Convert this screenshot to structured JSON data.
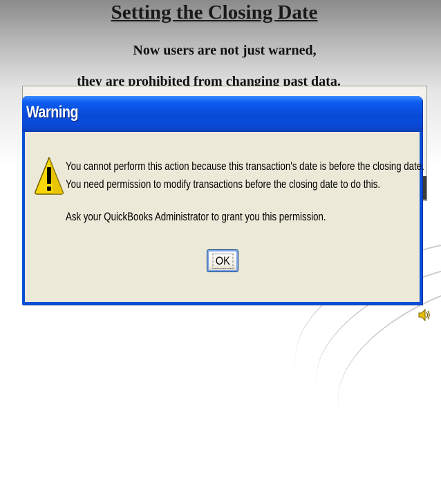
{
  "slide": {
    "title": "Setting the Closing Date",
    "subtitle_line1": "Now users are not just warned,",
    "subtitle_line2": "they are prohibited from changing past data."
  },
  "dialog": {
    "title": "Warning",
    "message_line1": "You cannot perform this action because this transaction's date is before the closing date.",
    "message_line2": "You need permission to modify transactions before the closing date to do this.",
    "message_line3": "Ask your QuickBooks Administrator to grant you this permission.",
    "ok_label": "OK",
    "icon": "warning-icon"
  },
  "audio_icon": "speaker-icon",
  "colors": {
    "titlebar": "#0a4fd6",
    "dialog_body": "#ece9d8",
    "warning_icon": "#f5d000"
  }
}
